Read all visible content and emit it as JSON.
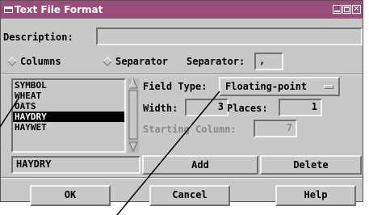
{
  "window": {
    "title": "Text File Format"
  },
  "description": {
    "label": "Description:",
    "value": ""
  },
  "mode": {
    "columns_label": "Columns",
    "separator_label": "Separator",
    "separator_field_label": "Separator:",
    "separator_value": ","
  },
  "fields": {
    "items": [
      "SYMBOL",
      "WHEAT",
      "OATS",
      "HAYDRY",
      "HAYWET"
    ],
    "selected": "HAYDRY"
  },
  "field_type": {
    "label": "Field Type:",
    "value": "Floating-point"
  },
  "width": {
    "label": "Width:",
    "value": "3"
  },
  "places": {
    "label": "Places:",
    "value": "1"
  },
  "starting_column": {
    "label": "Starting Column:",
    "value": "7"
  },
  "edit": {
    "name_value": "HAYDRY",
    "add_label": "Add",
    "delete_label": "Delete"
  },
  "footer": {
    "ok_label": "OK",
    "cancel_label": "Cancel",
    "help_label": "Help"
  },
  "colors": {
    "titlebar": "#9a4d78",
    "panel": "#c8c8c8",
    "selection": "#000000"
  }
}
